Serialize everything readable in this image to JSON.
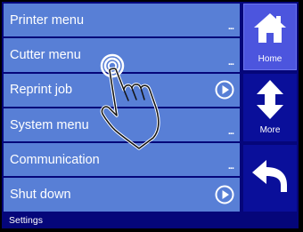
{
  "menu": {
    "items": [
      {
        "label": "Printer menu",
        "indicator": "..."
      },
      {
        "label": "Cutter menu",
        "indicator": "..."
      },
      {
        "label": "Reprint job",
        "indicator": "play"
      },
      {
        "label": "System menu",
        "indicator": "..."
      },
      {
        "label": "Communication",
        "indicator": "..."
      },
      {
        "label": "Shut down",
        "indicator": "play"
      }
    ]
  },
  "side": {
    "home": {
      "label": "Home",
      "icon": "home-icon"
    },
    "more": {
      "label": "More",
      "icon": "up-down-arrow-icon"
    },
    "back": {
      "icon": "back-arrow-icon"
    }
  },
  "status": {
    "text": "Settings"
  },
  "colors": {
    "background": "#05067a",
    "menu_item": "#587fd6",
    "side_button": "#4c55de",
    "side_button_dark": "#0a0f9a",
    "text": "#ffffff"
  }
}
